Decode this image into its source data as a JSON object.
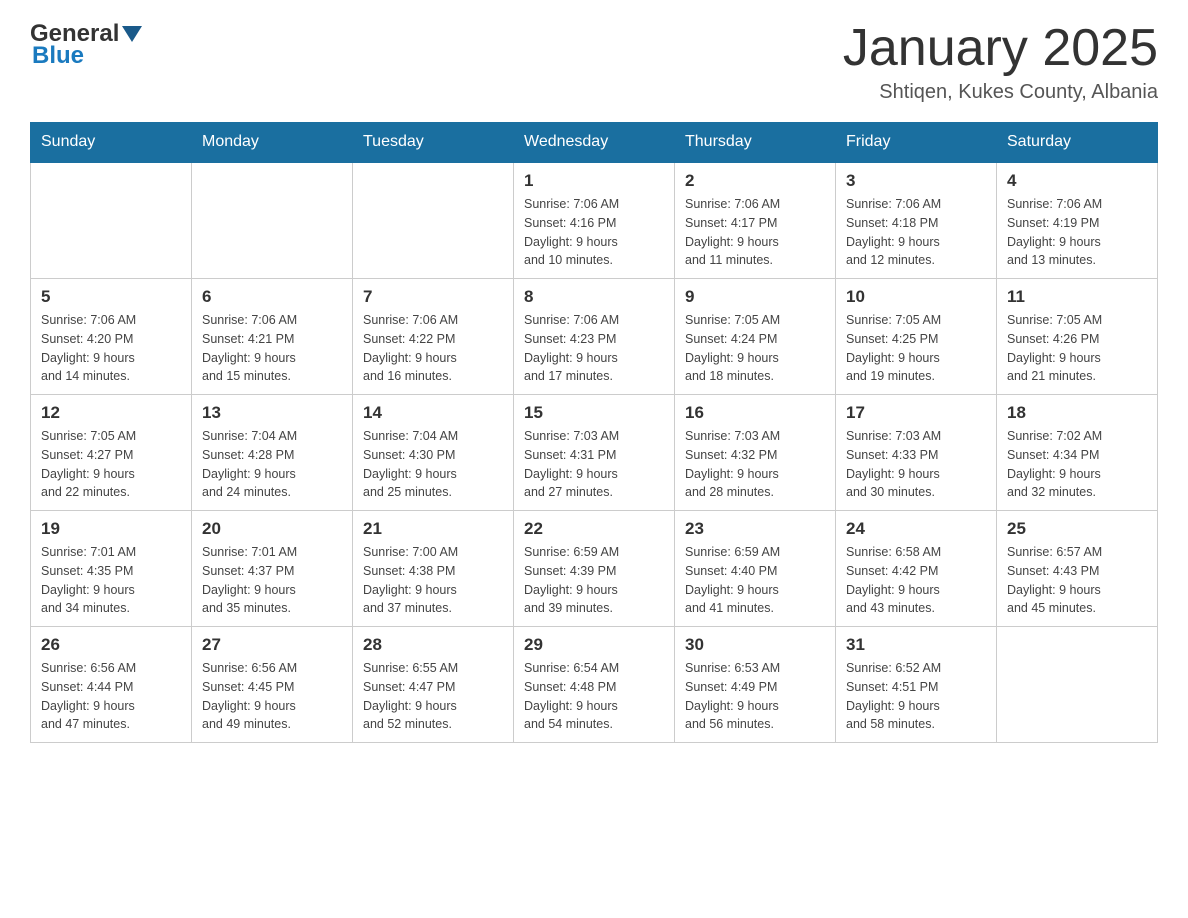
{
  "header": {
    "logo": {
      "general": "General",
      "blue": "Blue"
    },
    "title": "January 2025",
    "subtitle": "Shtiqen, Kukes County, Albania"
  },
  "calendar": {
    "days": [
      "Sunday",
      "Monday",
      "Tuesday",
      "Wednesday",
      "Thursday",
      "Friday",
      "Saturday"
    ],
    "weeks": [
      [
        {
          "num": "",
          "info": ""
        },
        {
          "num": "",
          "info": ""
        },
        {
          "num": "",
          "info": ""
        },
        {
          "num": "1",
          "info": "Sunrise: 7:06 AM\nSunset: 4:16 PM\nDaylight: 9 hours\nand 10 minutes."
        },
        {
          "num": "2",
          "info": "Sunrise: 7:06 AM\nSunset: 4:17 PM\nDaylight: 9 hours\nand 11 minutes."
        },
        {
          "num": "3",
          "info": "Sunrise: 7:06 AM\nSunset: 4:18 PM\nDaylight: 9 hours\nand 12 minutes."
        },
        {
          "num": "4",
          "info": "Sunrise: 7:06 AM\nSunset: 4:19 PM\nDaylight: 9 hours\nand 13 minutes."
        }
      ],
      [
        {
          "num": "5",
          "info": "Sunrise: 7:06 AM\nSunset: 4:20 PM\nDaylight: 9 hours\nand 14 minutes."
        },
        {
          "num": "6",
          "info": "Sunrise: 7:06 AM\nSunset: 4:21 PM\nDaylight: 9 hours\nand 15 minutes."
        },
        {
          "num": "7",
          "info": "Sunrise: 7:06 AM\nSunset: 4:22 PM\nDaylight: 9 hours\nand 16 minutes."
        },
        {
          "num": "8",
          "info": "Sunrise: 7:06 AM\nSunset: 4:23 PM\nDaylight: 9 hours\nand 17 minutes."
        },
        {
          "num": "9",
          "info": "Sunrise: 7:05 AM\nSunset: 4:24 PM\nDaylight: 9 hours\nand 18 minutes."
        },
        {
          "num": "10",
          "info": "Sunrise: 7:05 AM\nSunset: 4:25 PM\nDaylight: 9 hours\nand 19 minutes."
        },
        {
          "num": "11",
          "info": "Sunrise: 7:05 AM\nSunset: 4:26 PM\nDaylight: 9 hours\nand 21 minutes."
        }
      ],
      [
        {
          "num": "12",
          "info": "Sunrise: 7:05 AM\nSunset: 4:27 PM\nDaylight: 9 hours\nand 22 minutes."
        },
        {
          "num": "13",
          "info": "Sunrise: 7:04 AM\nSunset: 4:28 PM\nDaylight: 9 hours\nand 24 minutes."
        },
        {
          "num": "14",
          "info": "Sunrise: 7:04 AM\nSunset: 4:30 PM\nDaylight: 9 hours\nand 25 minutes."
        },
        {
          "num": "15",
          "info": "Sunrise: 7:03 AM\nSunset: 4:31 PM\nDaylight: 9 hours\nand 27 minutes."
        },
        {
          "num": "16",
          "info": "Sunrise: 7:03 AM\nSunset: 4:32 PM\nDaylight: 9 hours\nand 28 minutes."
        },
        {
          "num": "17",
          "info": "Sunrise: 7:03 AM\nSunset: 4:33 PM\nDaylight: 9 hours\nand 30 minutes."
        },
        {
          "num": "18",
          "info": "Sunrise: 7:02 AM\nSunset: 4:34 PM\nDaylight: 9 hours\nand 32 minutes."
        }
      ],
      [
        {
          "num": "19",
          "info": "Sunrise: 7:01 AM\nSunset: 4:35 PM\nDaylight: 9 hours\nand 34 minutes."
        },
        {
          "num": "20",
          "info": "Sunrise: 7:01 AM\nSunset: 4:37 PM\nDaylight: 9 hours\nand 35 minutes."
        },
        {
          "num": "21",
          "info": "Sunrise: 7:00 AM\nSunset: 4:38 PM\nDaylight: 9 hours\nand 37 minutes."
        },
        {
          "num": "22",
          "info": "Sunrise: 6:59 AM\nSunset: 4:39 PM\nDaylight: 9 hours\nand 39 minutes."
        },
        {
          "num": "23",
          "info": "Sunrise: 6:59 AM\nSunset: 4:40 PM\nDaylight: 9 hours\nand 41 minutes."
        },
        {
          "num": "24",
          "info": "Sunrise: 6:58 AM\nSunset: 4:42 PM\nDaylight: 9 hours\nand 43 minutes."
        },
        {
          "num": "25",
          "info": "Sunrise: 6:57 AM\nSunset: 4:43 PM\nDaylight: 9 hours\nand 45 minutes."
        }
      ],
      [
        {
          "num": "26",
          "info": "Sunrise: 6:56 AM\nSunset: 4:44 PM\nDaylight: 9 hours\nand 47 minutes."
        },
        {
          "num": "27",
          "info": "Sunrise: 6:56 AM\nSunset: 4:45 PM\nDaylight: 9 hours\nand 49 minutes."
        },
        {
          "num": "28",
          "info": "Sunrise: 6:55 AM\nSunset: 4:47 PM\nDaylight: 9 hours\nand 52 minutes."
        },
        {
          "num": "29",
          "info": "Sunrise: 6:54 AM\nSunset: 4:48 PM\nDaylight: 9 hours\nand 54 minutes."
        },
        {
          "num": "30",
          "info": "Sunrise: 6:53 AM\nSunset: 4:49 PM\nDaylight: 9 hours\nand 56 minutes."
        },
        {
          "num": "31",
          "info": "Sunrise: 6:52 AM\nSunset: 4:51 PM\nDaylight: 9 hours\nand 58 minutes."
        },
        {
          "num": "",
          "info": ""
        }
      ]
    ]
  }
}
